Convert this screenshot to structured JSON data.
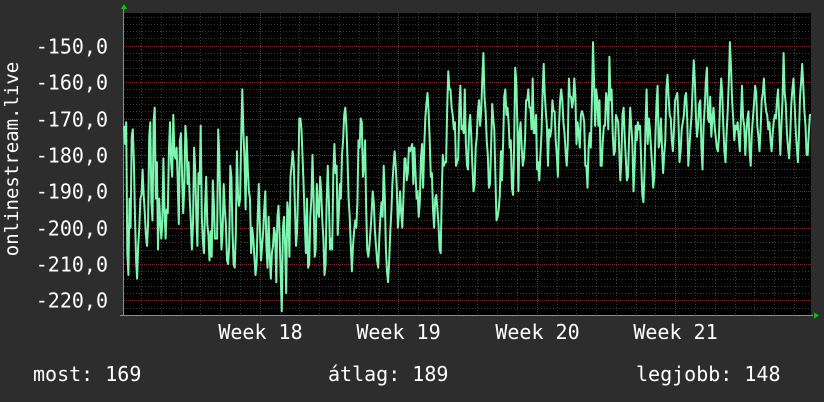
{
  "chart_data": {
    "type": "line",
    "ylabel": "onlinestream.live",
    "ylim": [
      -224,
      -141
    ],
    "yticks": [
      -220,
      -210,
      -200,
      -190,
      -180,
      -170,
      -160,
      -150
    ],
    "ytick_labels": [
      "-220,0",
      "-210,0",
      "-200,0",
      "-190,0",
      "-180,0",
      "-170,0",
      "-160,0",
      "-150,0"
    ],
    "xlim": [
      17.02,
      21.98
    ],
    "xticks": [
      18,
      19,
      20,
      21
    ],
    "xtick_labels": [
      "Week 18",
      "Week 19",
      "Week 20",
      "Week 21"
    ],
    "grid": true,
    "line_color": "#7ef5b0",
    "series": [
      {
        "values": [
          -172,
          -177,
          -171,
          -207,
          -213,
          -192,
          -200,
          -175,
          -173,
          -182,
          -197,
          -209,
          -214,
          -205,
          -200,
          -192,
          -191,
          -184,
          -191,
          -196,
          -202,
          -205,
          -199,
          -175,
          -171,
          -193,
          -198,
          -171,
          -167,
          -192,
          -182,
          -206,
          -192,
          -198,
          -203,
          -199,
          -181,
          -195,
          -203,
          -195,
          -196,
          -179,
          -171,
          -182,
          -186,
          -169,
          -180,
          -181,
          -178,
          -187,
          -199,
          -176,
          -174,
          -186,
          -196,
          -189,
          -172,
          -176,
          -188,
          -182,
          -192,
          -198,
          -206,
          -199,
          -178,
          -184,
          -197,
          -205,
          -185,
          -188,
          -172,
          -197,
          -204,
          -207,
          -194,
          -186,
          -199,
          -202,
          -209,
          -201,
          -208,
          -187,
          -193,
          -203,
          -203,
          -203,
          -173,
          -180,
          -196,
          -206,
          -201,
          -188,
          -195,
          -199,
          -209,
          -210,
          -205,
          -183,
          -186,
          -201,
          -210,
          -211,
          -202,
          -179,
          -191,
          -194,
          -192,
          -175,
          -162,
          -174,
          -181,
          -195,
          -175,
          -184,
          -190,
          -192,
          -207,
          -200,
          -203,
          -208,
          -213,
          -210,
          -197,
          -188,
          -200,
          -209,
          -205,
          -201,
          -195,
          -190,
          -205,
          -211,
          -197,
          -208,
          -214,
          -207,
          -205,
          -200,
          -202,
          -215,
          -197,
          -194,
          -202,
          -213,
          -223,
          -200,
          -197,
          -205,
          -218,
          -193,
          -196,
          -208,
          -186,
          -183,
          -179,
          -183,
          -194,
          -205,
          -201,
          -188,
          -170,
          -170,
          -173,
          -181,
          -189,
          -199,
          -207,
          -192,
          -211,
          -210,
          -197,
          -192,
          -180,
          -192,
          -208,
          -206,
          -188,
          -195,
          -197,
          -186,
          -190,
          -198,
          -203,
          -213,
          -210,
          -192,
          -183,
          -193,
          -206,
          -203,
          -206,
          -185,
          -177,
          -185,
          -183,
          -202,
          -196,
          -188,
          -192,
          -180,
          -176,
          -169,
          -167,
          -172,
          -181,
          -192,
          -197,
          -205,
          -212,
          -205,
          -201,
          -198,
          -200,
          -193,
          -176,
          -178,
          -170,
          -171,
          -186,
          -183,
          -176,
          -194,
          -206,
          -208,
          -205,
          -201,
          -196,
          -190,
          -193,
          -201,
          -205,
          -209,
          -211,
          -203,
          -197,
          -193,
          -197,
          -183,
          -191,
          -206,
          -212,
          -215,
          -209,
          -201,
          -196,
          -188,
          -183,
          -179,
          -183,
          -189,
          -200,
          -196,
          -190,
          -196,
          -200,
          -192,
          -181,
          -181,
          -187,
          -185,
          -178,
          -179,
          -178,
          -177,
          -188,
          -178,
          -185,
          -192,
          -190,
          -197,
          -193,
          -181,
          -177,
          -189,
          -178,
          -170,
          -166,
          -163,
          -168,
          -176,
          -186,
          -185,
          -195,
          -200,
          -192,
          -191,
          -195,
          -199,
          -206,
          -207,
          -190,
          -180,
          -183,
          -182,
          -182,
          -167,
          -157,
          -162,
          -162,
          -167,
          -169,
          -173,
          -171,
          -183,
          -182,
          -181,
          -167,
          -161,
          -173,
          -172,
          -174,
          -162,
          -177,
          -183,
          -184,
          -172,
          -169,
          -175,
          -183,
          -190,
          -188,
          -178,
          -175,
          -168,
          -165,
          -172,
          -168,
          -159,
          -152,
          -164,
          -168,
          -176,
          -180,
          -189,
          -188,
          -178,
          -166,
          -170,
          -173,
          -186,
          -198,
          -197,
          -195,
          -191,
          -179,
          -187,
          -177,
          -164,
          -162,
          -169,
          -167,
          -171,
          -178,
          -176,
          -189,
          -191,
          -178,
          -156,
          -160,
          -172,
          -190,
          -174,
          -171,
          -178,
          -183,
          -181,
          -176,
          -165,
          -165,
          -162,
          -167,
          -167,
          -173,
          -159,
          -174,
          -174,
          -169,
          -184,
          -182,
          -187,
          -180,
          -174,
          -163,
          -155,
          -163,
          -168,
          -172,
          -183,
          -173,
          -175,
          -173,
          -165,
          -168,
          -168,
          -176,
          -180,
          -186,
          -172,
          -165,
          -162,
          -165,
          -171,
          -174,
          -179,
          -183,
          -177,
          -159,
          -164,
          -164,
          -167,
          -165,
          -159,
          -164,
          -177,
          -171,
          -174,
          -178,
          -169,
          -168,
          -169,
          -171,
          -183,
          -183,
          -189,
          -178,
          -174,
          -178,
          -165,
          -149,
          -160,
          -172,
          -162,
          -165,
          -172,
          -165,
          -183,
          -183,
          -176,
          -172,
          -172,
          -163,
          -165,
          -173,
          -153,
          -165,
          -162,
          -174,
          -180,
          -179,
          -169,
          -170,
          -171,
          -179,
          -187,
          -181,
          -169,
          -167,
          -175,
          -181,
          -187,
          -186,
          -175,
          -167,
          -172,
          -177,
          -190,
          -183,
          -172,
          -176,
          -171,
          -173,
          -172,
          -182,
          -191,
          -193,
          -185,
          -171,
          -162,
          -177,
          -170,
          -173,
          -178,
          -183,
          -189,
          -186,
          -175,
          -166,
          -161,
          -178,
          -176,
          -170,
          -178,
          -185,
          -180,
          -176,
          -162,
          -158,
          -164,
          -169,
          -170,
          -176,
          -179,
          -173,
          -165,
          -164,
          -163,
          -170,
          -182,
          -179,
          -173,
          -171,
          -169,
          -164,
          -163,
          -170,
          -183,
          -178,
          -173,
          -169,
          -161,
          -154,
          -160,
          -170,
          -175,
          -172,
          -166,
          -165,
          -178,
          -184,
          -172,
          -167,
          -160,
          -156,
          -170,
          -171,
          -164,
          -175,
          -170,
          -167,
          -172,
          -175,
          -178,
          -179,
          -175,
          -165,
          -159,
          -163,
          -172,
          -179,
          -182,
          -174,
          -168,
          -160,
          -149,
          -156,
          -165,
          -170,
          -176,
          -172,
          -173,
          -171,
          -175,
          -179,
          -170,
          -161,
          -170,
          -172,
          -180,
          -174,
          -170,
          -168,
          -179,
          -183,
          -174,
          -170,
          -166,
          -161,
          -163,
          -172,
          -175,
          -179,
          -173,
          -165,
          -163,
          -159,
          -165,
          -168,
          -169,
          -173,
          -171,
          -176,
          -179,
          -174,
          -171,
          -169,
          -170,
          -165,
          -162,
          -171,
          -180,
          -172,
          -165,
          -152,
          -163,
          -166,
          -174,
          -178,
          -181,
          -175,
          -166,
          -162,
          -159,
          -166,
          -173,
          -178,
          -182,
          -175,
          -164,
          -160,
          -155,
          -161,
          -168,
          -172,
          -180,
          -180,
          -174,
          -169,
          -169
        ]
      }
    ]
  },
  "footer": {
    "current_label": "most:",
    "current_value": "169",
    "average_label": "átlag:",
    "average_value": "189",
    "best_label": "legjobb:",
    "best_value": "148"
  }
}
